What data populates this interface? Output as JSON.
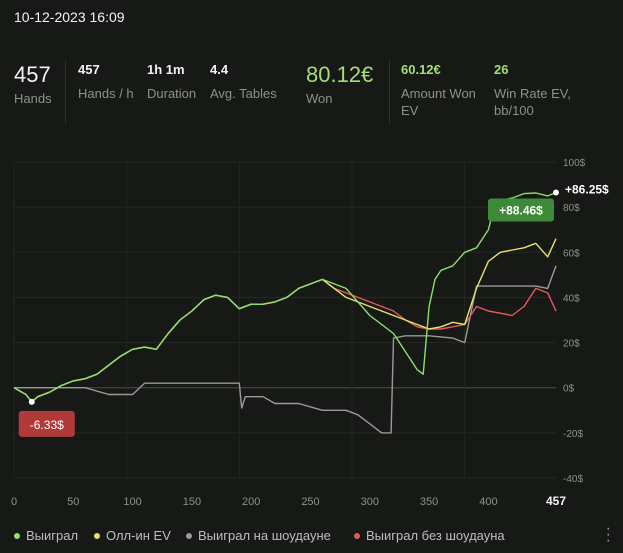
{
  "session": {
    "datetime": "10-12-2023 16:09"
  },
  "stats": {
    "hands": {
      "value": "457",
      "label": "Hands"
    },
    "hands_per_hour": {
      "value": "457",
      "label": "Hands / h"
    },
    "duration": {
      "value": "1h 1m",
      "label": "Duration"
    },
    "avg_tables": {
      "value": "4.4",
      "label": "Avg. Tables"
    },
    "won": {
      "value": "80.12€",
      "label": "Won"
    },
    "amount_won_ev": {
      "value": "60.12€",
      "label": "Amount Won EV"
    },
    "win_rate_ev": {
      "value": "26",
      "label": "Win Rate EV, bb/100"
    }
  },
  "chart_data": {
    "type": "line",
    "x_ticks": [
      "0",
      "50",
      "100",
      "150",
      "200",
      "250",
      "300",
      "350",
      "400"
    ],
    "x_max_label": "457",
    "xlim": [
      0,
      457
    ],
    "y_ticks": [
      "100$",
      "80$",
      "60$",
      "40$",
      "20$",
      "0$",
      "-20$",
      "-40$"
    ],
    "ylim": [
      -40,
      100
    ],
    "badges": {
      "max_won": "+86.25$",
      "end_won": "+88.46$",
      "min_won": "-6.33$"
    },
    "series": [
      {
        "name": "Выиграл",
        "color": "#8ce068",
        "points": [
          [
            0,
            0
          ],
          [
            10,
            -3
          ],
          [
            15,
            -6.3
          ],
          [
            20,
            -4
          ],
          [
            30,
            -2
          ],
          [
            40,
            1
          ],
          [
            50,
            3
          ],
          [
            60,
            4
          ],
          [
            70,
            6
          ],
          [
            80,
            10
          ],
          [
            90,
            14
          ],
          [
            100,
            17
          ],
          [
            110,
            18
          ],
          [
            120,
            17
          ],
          [
            130,
            24
          ],
          [
            140,
            30
          ],
          [
            150,
            34
          ],
          [
            160,
            39
          ],
          [
            170,
            41
          ],
          [
            180,
            40
          ],
          [
            190,
            35
          ],
          [
            200,
            37
          ],
          [
            210,
            37
          ],
          [
            220,
            38
          ],
          [
            230,
            40
          ],
          [
            240,
            44
          ],
          [
            250,
            46
          ],
          [
            260,
            48
          ],
          [
            270,
            46
          ],
          [
            280,
            44
          ],
          [
            290,
            38
          ],
          [
            300,
            32
          ],
          [
            310,
            28
          ],
          [
            320,
            24
          ],
          [
            330,
            16
          ],
          [
            340,
            8
          ],
          [
            345,
            6
          ],
          [
            350,
            36
          ],
          [
            355,
            48
          ],
          [
            360,
            52
          ],
          [
            370,
            54
          ],
          [
            380,
            60
          ],
          [
            390,
            62
          ],
          [
            400,
            70
          ],
          [
            405,
            80
          ],
          [
            410,
            83
          ],
          [
            420,
            84
          ],
          [
            430,
            86
          ],
          [
            440,
            86.25
          ],
          [
            450,
            85
          ],
          [
            457,
            86.5
          ]
        ]
      },
      {
        "name": "Олл-ин EV",
        "color": "#e8e16a",
        "points": [
          [
            0,
            0
          ],
          [
            10,
            -3
          ],
          [
            15,
            -6.3
          ],
          [
            20,
            -4
          ],
          [
            30,
            -2
          ],
          [
            40,
            1
          ],
          [
            50,
            3
          ],
          [
            60,
            4
          ],
          [
            70,
            6
          ],
          [
            80,
            10
          ],
          [
            90,
            14
          ],
          [
            100,
            17
          ],
          [
            110,
            18
          ],
          [
            120,
            17
          ],
          [
            130,
            24
          ],
          [
            140,
            30
          ],
          [
            150,
            34
          ],
          [
            160,
            39
          ],
          [
            170,
            41
          ],
          [
            180,
            40
          ],
          [
            190,
            35
          ],
          [
            200,
            37
          ],
          [
            210,
            37
          ],
          [
            220,
            38
          ],
          [
            230,
            40
          ],
          [
            240,
            44
          ],
          [
            250,
            46
          ],
          [
            260,
            48
          ],
          [
            270,
            44
          ],
          [
            280,
            40
          ],
          [
            290,
            38
          ],
          [
            300,
            36
          ],
          [
            310,
            34
          ],
          [
            320,
            32
          ],
          [
            330,
            30
          ],
          [
            340,
            28
          ],
          [
            350,
            26
          ],
          [
            360,
            27
          ],
          [
            370,
            29
          ],
          [
            380,
            28
          ],
          [
            390,
            44
          ],
          [
            400,
            56
          ],
          [
            410,
            60
          ],
          [
            420,
            61
          ],
          [
            430,
            62
          ],
          [
            440,
            64
          ],
          [
            450,
            58
          ],
          [
            457,
            66
          ]
        ]
      },
      {
        "name": "Выиграл на шоудауне",
        "color": "#9a9a9a",
        "points": [
          [
            0,
            0
          ],
          [
            30,
            0
          ],
          [
            60,
            0
          ],
          [
            80,
            -3
          ],
          [
            100,
            -3
          ],
          [
            110,
            2
          ],
          [
            140,
            2
          ],
          [
            160,
            2
          ],
          [
            190,
            2
          ],
          [
            192,
            -9
          ],
          [
            195,
            -4
          ],
          [
            210,
            -4
          ],
          [
            220,
            -7
          ],
          [
            240,
            -7
          ],
          [
            260,
            -10
          ],
          [
            280,
            -10
          ],
          [
            290,
            -12
          ],
          [
            300,
            -16
          ],
          [
            310,
            -20
          ],
          [
            318,
            -20
          ],
          [
            320,
            22
          ],
          [
            330,
            23
          ],
          [
            350,
            23
          ],
          [
            370,
            22
          ],
          [
            380,
            20
          ],
          [
            390,
            45
          ],
          [
            400,
            45
          ],
          [
            420,
            45
          ],
          [
            440,
            45
          ],
          [
            450,
            44
          ],
          [
            457,
            54
          ]
        ]
      },
      {
        "name": "Выиграл без шоудауна",
        "color": "#e35b5b",
        "points": [
          [
            0,
            0
          ],
          [
            10,
            -3
          ],
          [
            15,
            -6.3
          ],
          [
            20,
            -4
          ],
          [
            30,
            -2
          ],
          [
            40,
            1
          ],
          [
            50,
            3
          ],
          [
            60,
            4
          ],
          [
            70,
            6
          ],
          [
            80,
            10
          ],
          [
            90,
            14
          ],
          [
            100,
            17
          ],
          [
            110,
            18
          ],
          [
            120,
            17
          ],
          [
            130,
            24
          ],
          [
            140,
            30
          ],
          [
            150,
            34
          ],
          [
            160,
            39
          ],
          [
            170,
            41
          ],
          [
            180,
            40
          ],
          [
            190,
            35
          ],
          [
            200,
            37
          ],
          [
            210,
            37
          ],
          [
            220,
            38
          ],
          [
            230,
            40
          ],
          [
            240,
            44
          ],
          [
            250,
            46
          ],
          [
            260,
            48
          ],
          [
            270,
            44
          ],
          [
            280,
            42
          ],
          [
            290,
            40
          ],
          [
            300,
            38
          ],
          [
            310,
            36
          ],
          [
            320,
            34
          ],
          [
            330,
            30
          ],
          [
            340,
            27
          ],
          [
            350,
            26
          ],
          [
            360,
            26
          ],
          [
            370,
            27
          ],
          [
            380,
            28
          ],
          [
            390,
            36
          ],
          [
            400,
            34
          ],
          [
            410,
            33
          ],
          [
            420,
            32
          ],
          [
            430,
            36
          ],
          [
            440,
            44
          ],
          [
            450,
            42
          ],
          [
            457,
            34
          ]
        ]
      }
    ]
  },
  "legend": [
    {
      "label": "Выиграл",
      "color": "#8ce068"
    },
    {
      "label": "Олл-ин EV",
      "color": "#e8e16a"
    },
    {
      "label": "Выиграл на шоудауне",
      "color": "#9a9a9a"
    },
    {
      "label": "Выиграл без шоудауна",
      "color": "#e35b5b"
    }
  ],
  "colors": {
    "background": "#171916",
    "won_badge": "#3e8a39",
    "lost_badge": "#b03a3a"
  },
  "menu_icon": "more-vertical-icon"
}
